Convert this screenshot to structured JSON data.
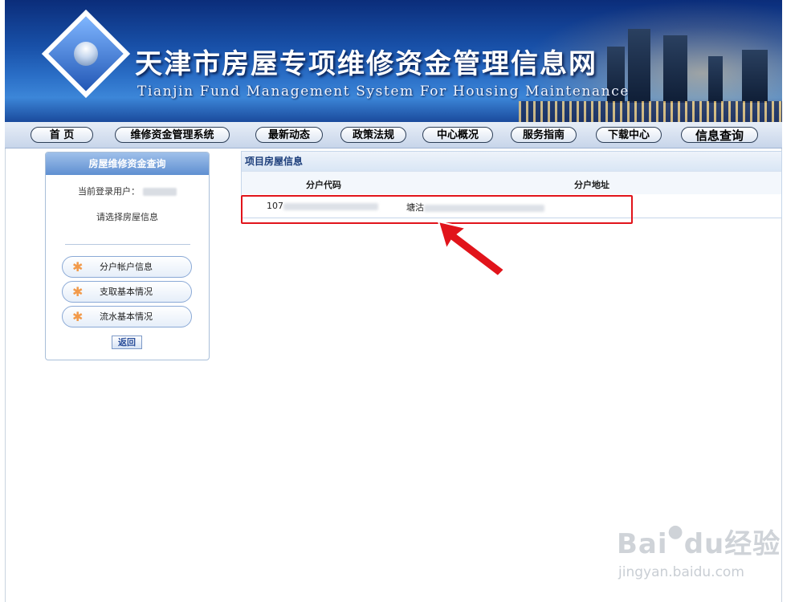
{
  "header": {
    "title": "天津市房屋专项维修资金管理信息网",
    "subtitle": "Tianjin Fund Management System For Housing Maintenance"
  },
  "nav": {
    "items": [
      {
        "label": "首  页"
      },
      {
        "label": "维修资金管理系统"
      },
      {
        "label": "最新动态"
      },
      {
        "label": "政策法规"
      },
      {
        "label": "中心概况"
      },
      {
        "label": "服务指南"
      },
      {
        "label": "下载中心"
      },
      {
        "label": "信息查询"
      }
    ]
  },
  "sidebar": {
    "title": "房屋维修资金查询",
    "user_label": "当前登录用户：",
    "select_hint": "请选择房屋信息",
    "items": [
      {
        "label": "分户帐户信息"
      },
      {
        "label": "支取基本情况"
      },
      {
        "label": "流水基本情况"
      }
    ],
    "back_label": "返回"
  },
  "main": {
    "section_title": "项目房屋信息",
    "columns": [
      "分户代码",
      "分户地址"
    ],
    "rows": [
      {
        "code_prefix": "107",
        "address_prefix": "塘沽"
      }
    ]
  },
  "watermark": {
    "brand": "Bai",
    "brand_mid": "du",
    "brand_suffix": "经验",
    "url": "jingyan.baidu.com"
  },
  "colors": {
    "highlight_border": "#e1141b",
    "arrow_fill": "#e1141b",
    "banner_blue": "#1850a8"
  }
}
